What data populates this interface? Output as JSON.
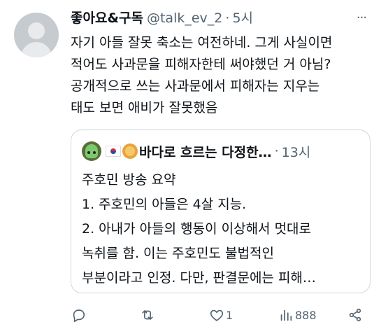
{
  "tweet": {
    "display_name": "좋아요&구독",
    "handle": "@talk_ev_2",
    "separator": "·",
    "time": "5시",
    "more_label": "···",
    "lines": [
      "자기 아들 잘못 축소는 여전하네. 그게 사실이면",
      "적어도 사과문을 피해자한테 써야했던 거 아님?",
      "공개적으로 쓰는 사과문에서 피해자는 지우는",
      "태도 보면 애비가 잘못했음"
    ]
  },
  "quote": {
    "emoji_icons": [
      "alien-avatar-icon",
      "korea-flag-icon",
      "lion-face-icon"
    ],
    "display_name": "바다로 흐르는 다정한…",
    "separator": "·",
    "time": "13시",
    "lines": [
      "주호민 방송 요약",
      "1. 주호민의 아들은 4살 지능.",
      "2. 아내가 아들의 행동이 이상해서 멋대로",
      "녹취를 함. 이는 주호민도 불법적인",
      "부분이라고 인정. 다만, 판결문에는 피해…"
    ]
  },
  "actions": {
    "reply_count": "",
    "retweet_count": "",
    "like_count": "1",
    "views_count": "888"
  },
  "colors": {
    "text": "#0f1419",
    "muted": "#536471",
    "border": "#cfd9de"
  }
}
